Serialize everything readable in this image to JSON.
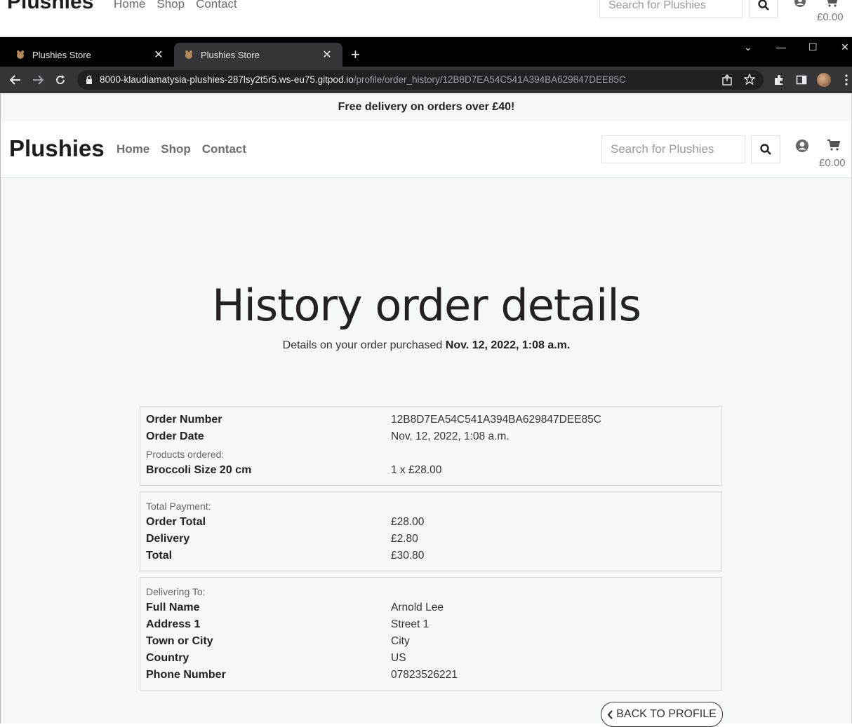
{
  "ghost_header": {
    "logo": "Plushies",
    "nav": [
      "Home",
      "Shop",
      "Contact"
    ],
    "search_placeholder": "Search for Plushies",
    "cart_total": "£0.00"
  },
  "browser": {
    "tabs": [
      {
        "title": "Plushies Store",
        "active": false
      },
      {
        "title": "Plushies Store",
        "active": true
      }
    ],
    "url_host": "8000-klaudiamatysia-plushies-287lsy2t5r5.ws-eu75.gitpod.io",
    "url_path": "/profile/order_history/12B8D7EA54C541A394BA629847DEE85C"
  },
  "banner": "Free delivery on orders over £40!",
  "navbar": {
    "logo": "Plushies",
    "links": [
      "Home",
      "Shop",
      "Contact"
    ],
    "search_placeholder": "Search for Plushies",
    "cart_total": "£0.00"
  },
  "page": {
    "title": "History order details",
    "subtitle_prefix": "Details on your order purchased ",
    "subtitle_date": "Nov. 12, 2022, 1:08 a.m."
  },
  "order": {
    "number_label": "Order Number",
    "number": "12B8D7EA54C541A394BA629847DEE85C",
    "date_label": "Order Date",
    "date": "Nov. 12, 2022, 1:08 a.m.",
    "products_heading": "Products ordered:",
    "items": [
      {
        "name": "Broccoli Size 20 cm",
        "qty_price": "1 x £28.00"
      }
    ]
  },
  "payment": {
    "heading": "Total Payment:",
    "rows": [
      {
        "label": "Order Total",
        "value": "£28.00"
      },
      {
        "label": "Delivery",
        "value": "£2.80"
      },
      {
        "label": "Total",
        "value": "£30.80"
      }
    ]
  },
  "delivery": {
    "heading": "Delivering To:",
    "rows": [
      {
        "label": "Full Name",
        "value": "Arnold Lee"
      },
      {
        "label": "Address 1",
        "value": "Street 1"
      },
      {
        "label": "Town or City",
        "value": "City"
      },
      {
        "label": "Country",
        "value": "US"
      },
      {
        "label": "Phone Number",
        "value": "07823526221"
      }
    ]
  },
  "back_button": "BACK TO PROFILE",
  "icons": {
    "search": "search-icon",
    "user": "user-icon",
    "cart": "cart-icon",
    "chevron": "chevron-left-icon"
  }
}
